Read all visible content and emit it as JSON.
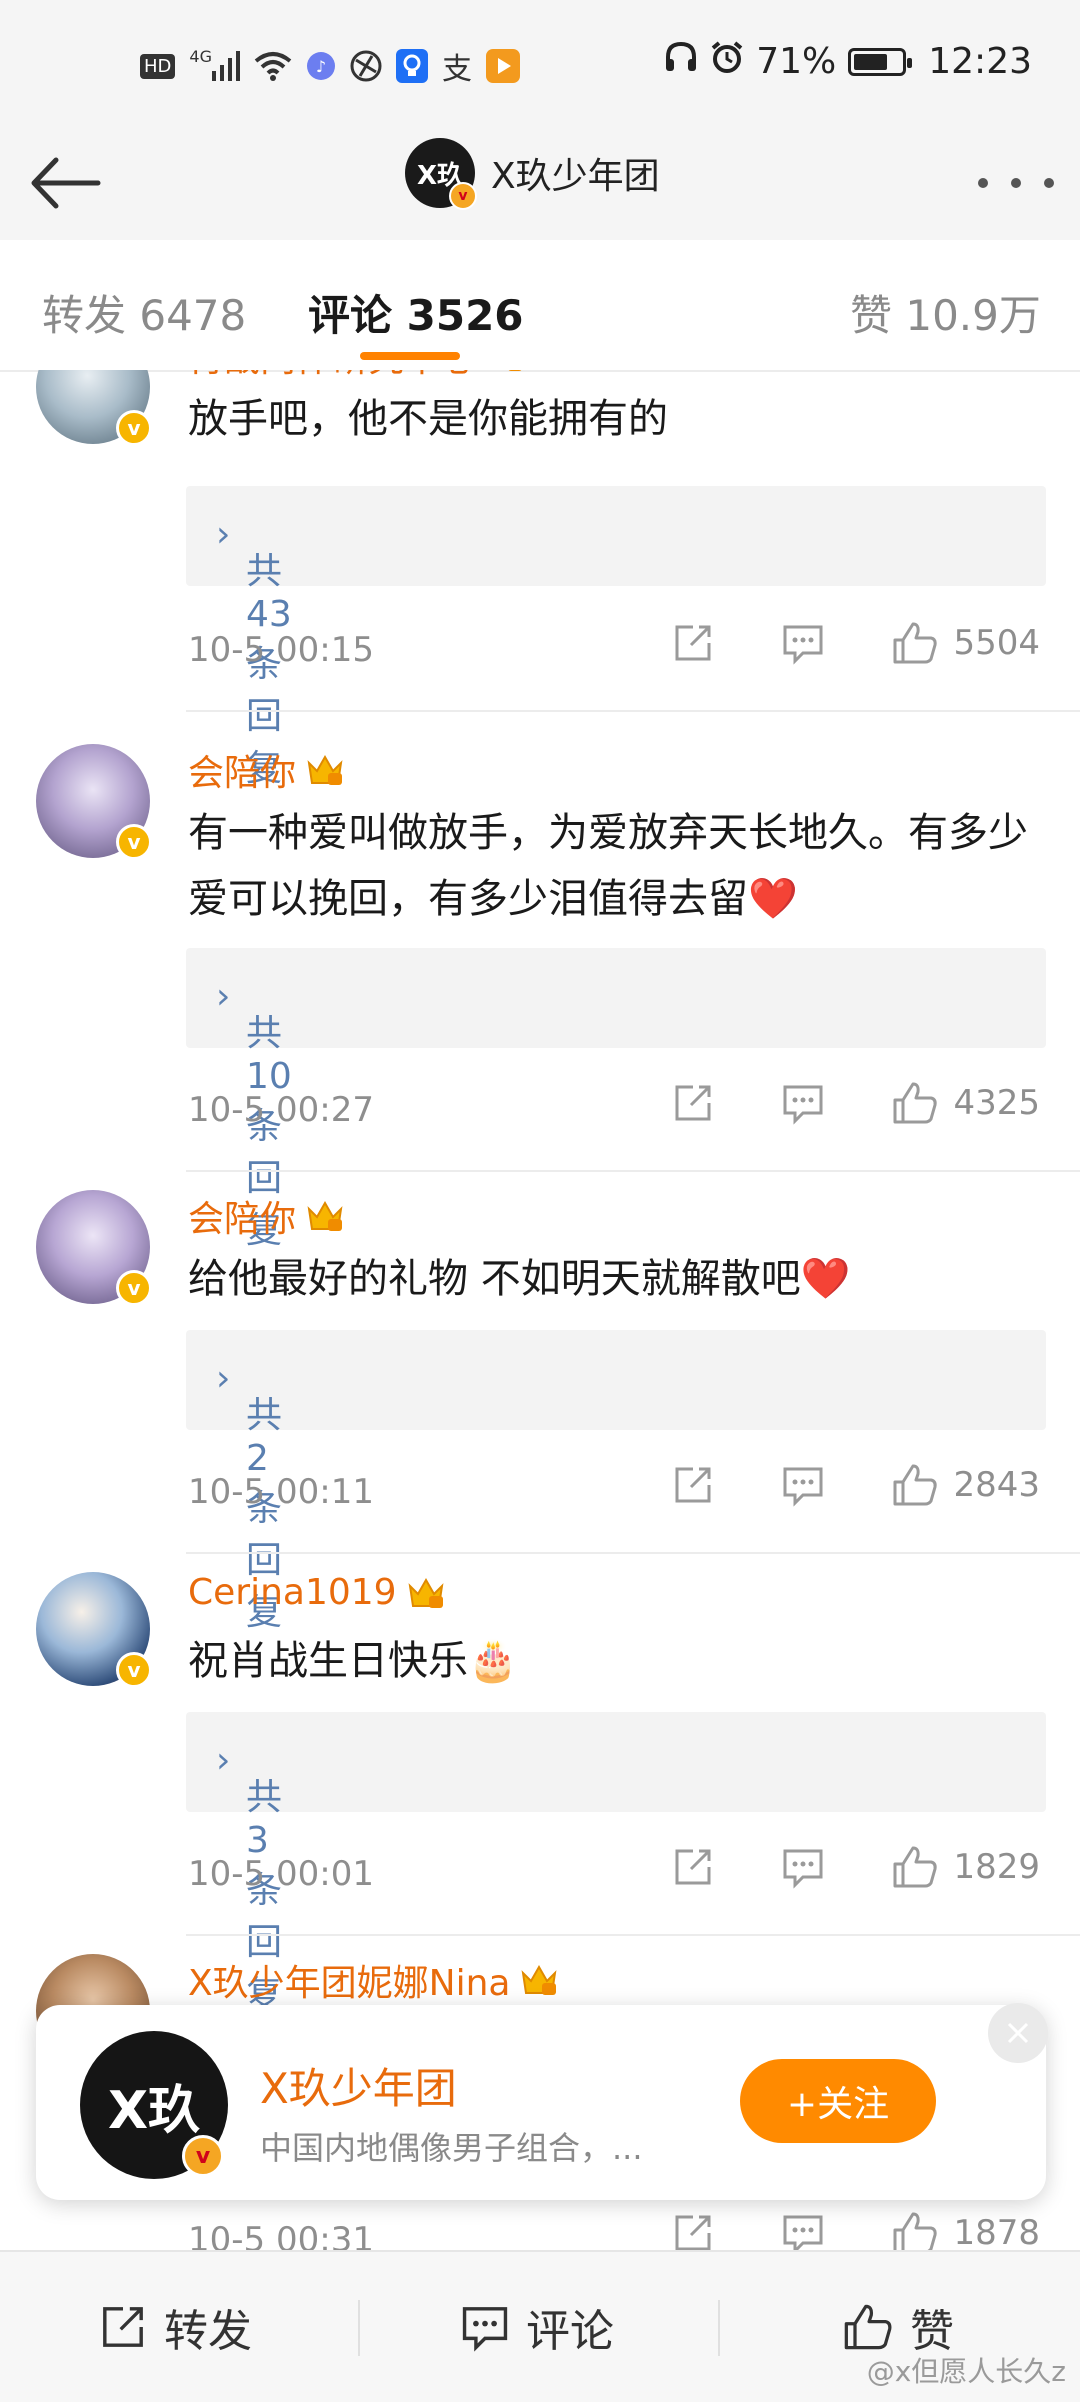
{
  "status_bar": {
    "left_icons": [
      "hd-icon",
      "signal-4g-icon",
      "wifi-icon",
      "music-icon",
      "browser-icon",
      "lightbulb-icon",
      "alipay-icon",
      "video-icon"
    ],
    "hd_text": "HD",
    "net_text": "4G",
    "alipay_glyph": "支",
    "battery_text": "71%",
    "battery_level": 0.71,
    "time": "12:23"
  },
  "nav": {
    "avatar_text": "X玖",
    "title": "X玖少年团"
  },
  "tabs": [
    {
      "label": "转发 6478",
      "active": false
    },
    {
      "label": "评论 3526",
      "active": true
    },
    {
      "label": "赞 10.9万",
      "active": false
    }
  ],
  "comments": [
    {
      "username": "肖战肉体研究中心",
      "text": "放手吧，他不是你能拥有的",
      "replies": "共43条回复",
      "time": "10-5 00:15",
      "likes": "5504"
    },
    {
      "username": "会陪你",
      "text": "有一种爱叫做放手，为爱放弃天长地久。有多少爱可以挽回，有多少泪值得去留❤️",
      "replies": "共10条回复",
      "time": "10-5 00:27",
      "likes": "4325"
    },
    {
      "username": "会陪你",
      "text": "给他最好的礼物 不如明天就解散吧❤️",
      "replies": "共2条回复",
      "time": "10-5 00:11",
      "likes": "2843"
    },
    {
      "username": "Cerina1019",
      "text": "祝肖战生日快乐🎂",
      "replies": "共3条回复",
      "time": "10-5 00:01",
      "likes": "1829"
    },
    {
      "username": "X玖少年团妮娜Nina",
      "text": "",
      "replies": "",
      "time": "10-5 00:31",
      "likes": "1878"
    }
  ],
  "reply_chevron": "›",
  "follow_card": {
    "avatar_text": "X玖",
    "name": "X玖少年团",
    "description": "中国内地偶像男子组合，...",
    "follow_label": "+关注"
  },
  "bottom_bar": {
    "repost_label": "转发",
    "comment_label": "评论",
    "like_label": "赞"
  },
  "watermark": "@x但愿人长久z",
  "colors": {
    "accent": "#ff8200",
    "username": "#e86b0c",
    "reply_link": "#5a7fb0",
    "verified": "#f7b500"
  }
}
